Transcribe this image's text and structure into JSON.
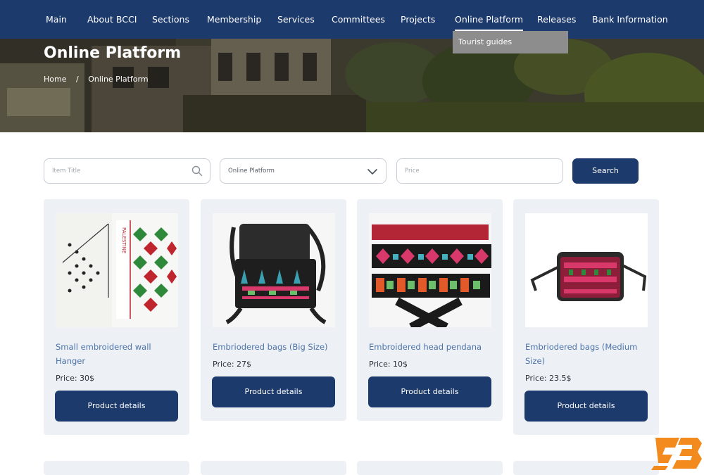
{
  "nav": {
    "items": [
      {
        "label": "Main"
      },
      {
        "label": "About BCCI"
      },
      {
        "label": "Sections"
      },
      {
        "label": "Membership"
      },
      {
        "label": "Services"
      },
      {
        "label": "Committees"
      },
      {
        "label": "Projects"
      },
      {
        "label": "Online Platform"
      },
      {
        "label": "Releases"
      },
      {
        "label": "Bank Information"
      }
    ],
    "dropdown": {
      "item": "Tourist guides"
    }
  },
  "hero": {
    "title": "Online Platform",
    "breadcrumb": {
      "home": "Home",
      "separator": "/",
      "current": "Online Platform"
    }
  },
  "filters": {
    "title_placeholder": "Item Title",
    "category_value": "Online Platform",
    "price_placeholder": "Price",
    "search_label": "Search"
  },
  "products": [
    {
      "title": "Small embroidered wall Hanger",
      "price": "Price: 30$",
      "button": "Product details"
    },
    {
      "title": "Embriodered bags (Big Size)",
      "price": "Price: 27$",
      "button": "Product details"
    },
    {
      "title": "Embroidered head pendana",
      "price": "Price: 10$",
      "button": "Product details"
    },
    {
      "title": "Embriodered bags (Medium Size)",
      "price": "Price: 23.5$",
      "button": "Product details"
    }
  ],
  "colors": {
    "nav": "#1d3a6c",
    "accent": "#1d3a6c",
    "card": "#edf1f6",
    "link": "#4d73a8"
  }
}
